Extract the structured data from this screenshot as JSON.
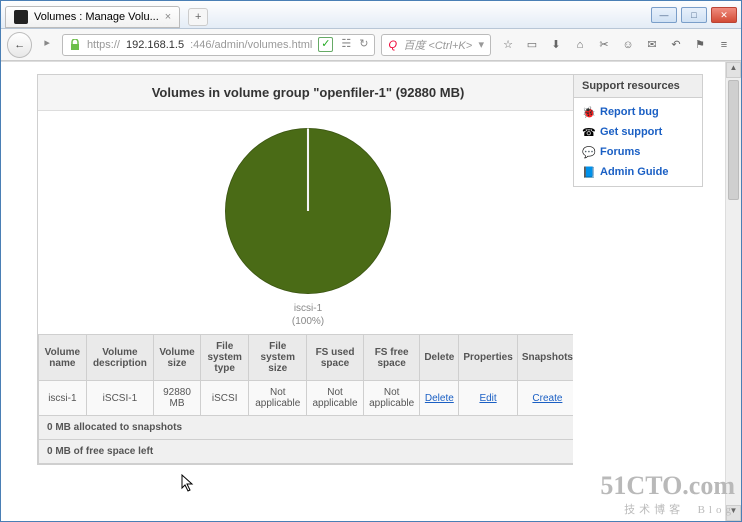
{
  "browser": {
    "tab_title": "Volumes : Manage Volu...",
    "url_proto": "https://",
    "url_host": "192.168.1.5",
    "url_path": ":446/admin/volumes.html",
    "search_placeholder": "百度 <Ctrl+K>"
  },
  "page": {
    "title": "Volumes in volume group \"openfiler-1\" (92880 MB)"
  },
  "chart_data": {
    "type": "pie",
    "title": "",
    "slices": [
      {
        "name": "iscsi-1",
        "value": 100,
        "color": "#4a6b16"
      }
    ],
    "label_name": "iscsi-1",
    "label_pct": "(100%)"
  },
  "table": {
    "headers": [
      "Volume name",
      "Volume description",
      "Volume size",
      "File system type",
      "File system size",
      "FS used space",
      "FS free space",
      "Delete",
      "Properties",
      "Snapshots"
    ],
    "rows": [
      {
        "name": "iscsi-1",
        "desc": "iSCSI-1",
        "size": "92880 MB",
        "fstype": "iSCSI",
        "fssize": "Not applicable",
        "fsused": "Not applicable",
        "fsfree": "Not applicable",
        "del": "Delete",
        "props": "Edit",
        "snap": "Create"
      }
    ],
    "footer1": "0 MB allocated to snapshots",
    "footer2": "0 MB of free space left"
  },
  "sidebar": {
    "title": "Support resources",
    "items": [
      {
        "label": "Report bug",
        "icon": "bug"
      },
      {
        "label": "Get support",
        "icon": "support"
      },
      {
        "label": "Forums",
        "icon": "forums"
      },
      {
        "label": "Admin Guide",
        "icon": "guide"
      }
    ]
  },
  "watermark": {
    "big": "51CTO.com",
    "small": "技术博客",
    "tag": "Blog"
  }
}
